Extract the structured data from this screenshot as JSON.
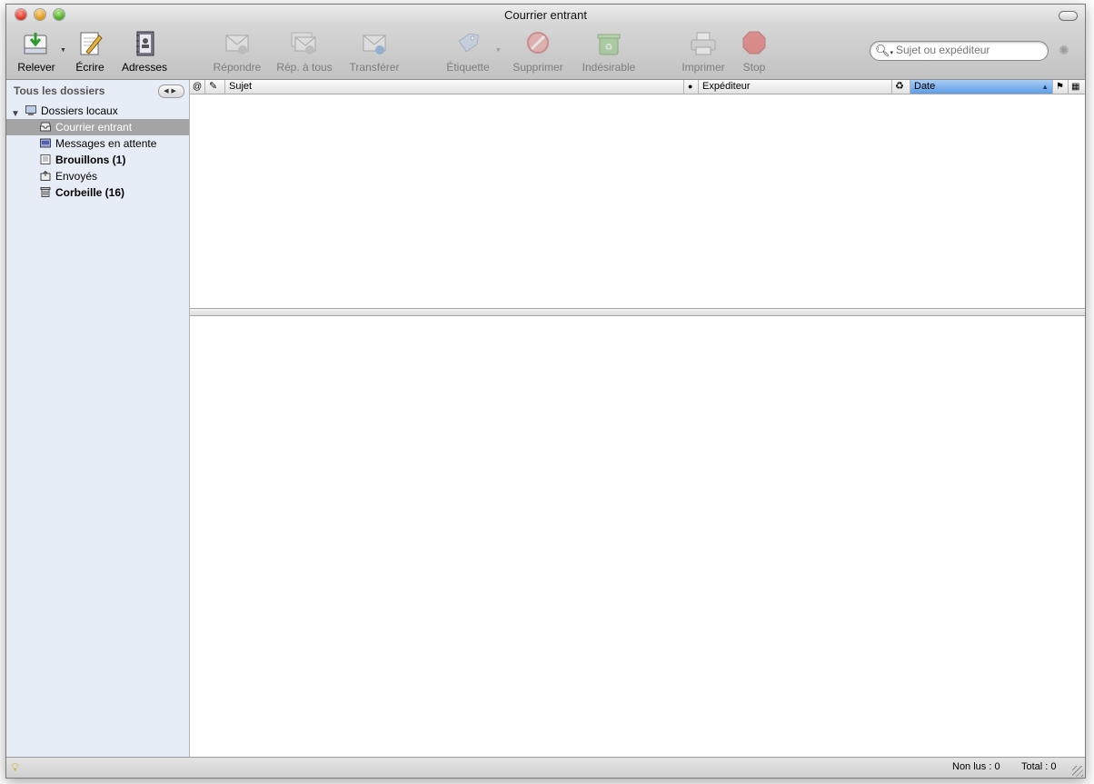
{
  "window": {
    "title": "Courrier entrant"
  },
  "toolbar": {
    "get_mail": "Relever",
    "write": "Écrire",
    "addresses": "Adresses",
    "reply": "Répondre",
    "reply_all": "Rép. à tous",
    "forward": "Transférer",
    "tag": "Étiquette",
    "delete": "Supprimer",
    "junk": "Indésirable",
    "print": "Imprimer",
    "stop": "Stop"
  },
  "search": {
    "placeholder": "Sujet ou expéditeur"
  },
  "sidebar": {
    "header": "Tous les dossiers",
    "root": "Dossiers locaux",
    "folders": [
      {
        "label": "Courrier entrant",
        "bold": false,
        "selected": true,
        "icon": "inbox-icon"
      },
      {
        "label": "Messages en attente",
        "bold": false,
        "selected": false,
        "icon": "outbox-icon"
      },
      {
        "label": "Brouillons (1)",
        "bold": true,
        "selected": false,
        "icon": "drafts-icon"
      },
      {
        "label": "Envoyés",
        "bold": false,
        "selected": false,
        "icon": "sent-icon"
      },
      {
        "label": "Corbeille (16)",
        "bold": true,
        "selected": false,
        "icon": "trash-icon"
      }
    ]
  },
  "columns": {
    "subject": "Sujet",
    "sender": "Expéditeur",
    "date": "Date"
  },
  "status": {
    "unread": "Non lus : 0",
    "total": "Total : 0"
  }
}
